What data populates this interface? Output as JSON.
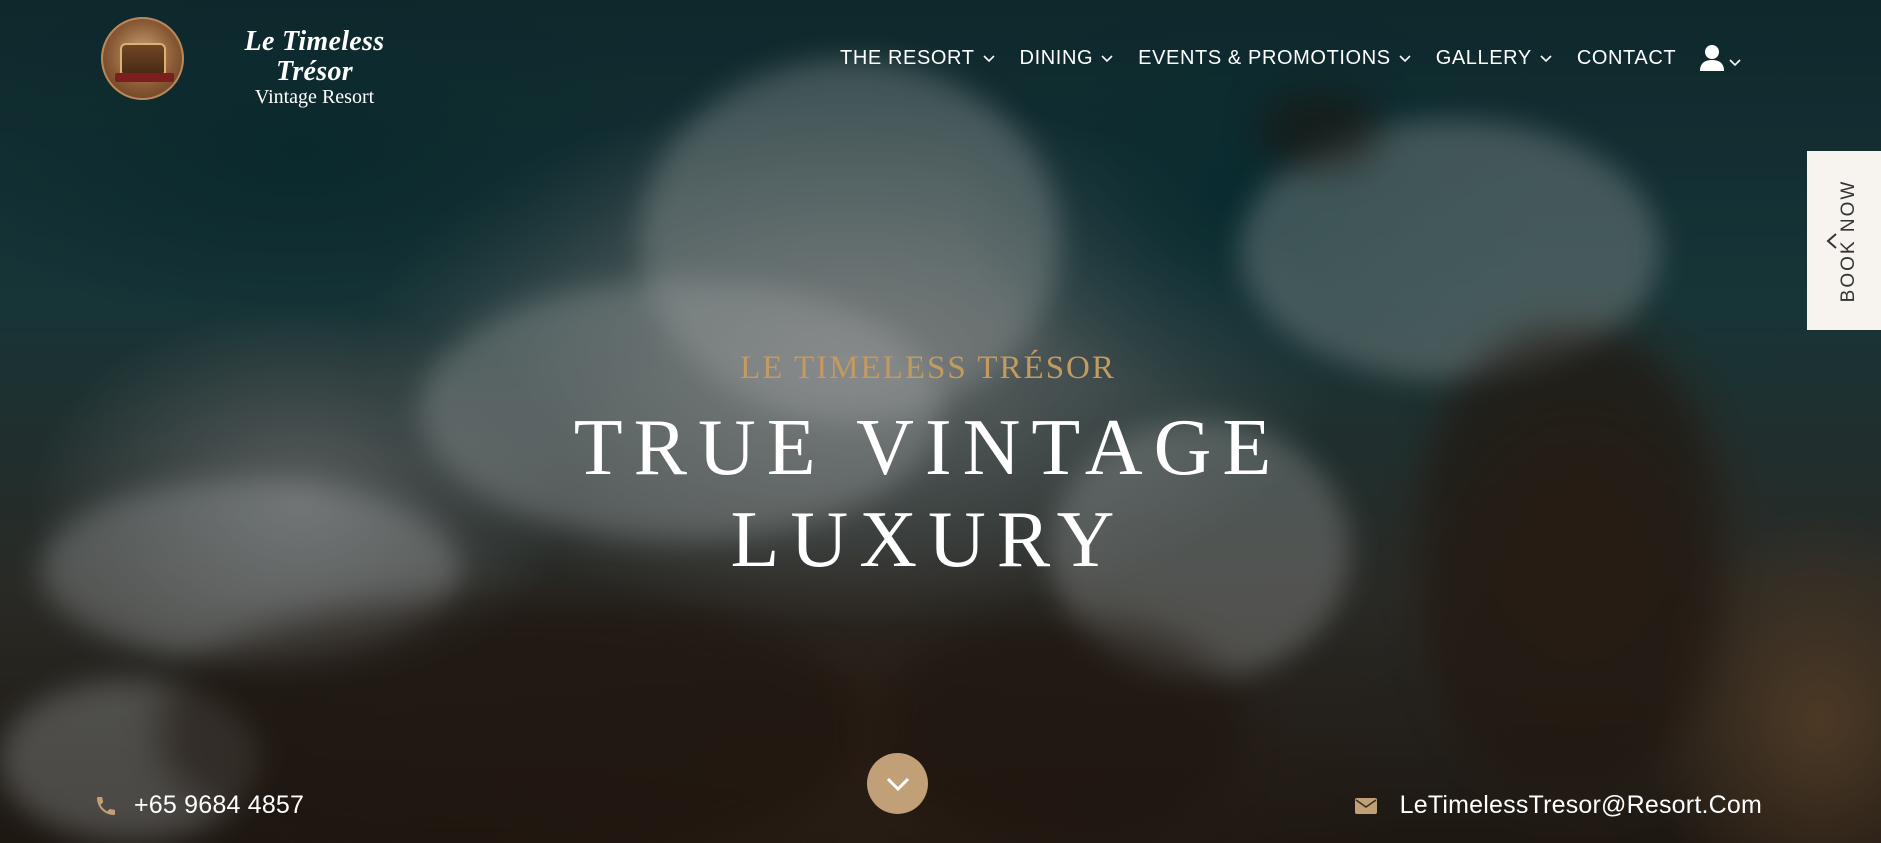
{
  "brand": {
    "title": "Le Timeless Trésor",
    "subtitle": "Vintage Resort",
    "logo_icon": "treasure-chest-logo"
  },
  "nav": {
    "items": [
      {
        "label": "THE RESORT",
        "has_dropdown": true
      },
      {
        "label": "DINING",
        "has_dropdown": true
      },
      {
        "label": "EVENTS & PROMOTIONS",
        "has_dropdown": true
      },
      {
        "label": "GALLERY",
        "has_dropdown": true
      },
      {
        "label": "CONTACT",
        "has_dropdown": false
      }
    ],
    "user_icon": "user-icon"
  },
  "book_tab": {
    "label": "BOOK NOW",
    "icon": "chevron-left-icon"
  },
  "hero": {
    "eyebrow": "LE TIMELESS TRÉSOR",
    "headline_line1": "TRUE VINTAGE",
    "headline_line2": "LUXURY",
    "scroll_icon": "chevron-down-icon"
  },
  "contact": {
    "phone": "+65 9684 4857",
    "email": "LeTimelessTresor@Resort.Com"
  },
  "colors": {
    "accent_gold": "#c39a5f",
    "scroll_button": "#c2a077",
    "book_tab_bg": "#f7f3ee"
  }
}
